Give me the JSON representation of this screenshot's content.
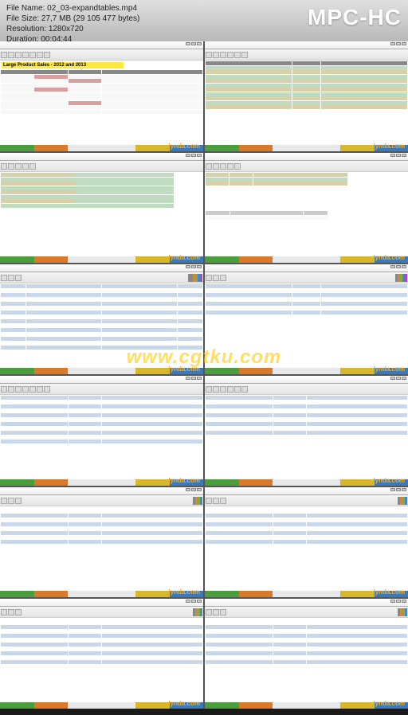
{
  "player": {
    "filename_label": "File Name:",
    "filename": "02_03-expandtables.mp4",
    "filesize_label": "File Size:",
    "filesize": "27,7 MB (29 105 477 bytes)",
    "resolution_label": "Resolution:",
    "resolution": "1280x720",
    "duration_label": "Duration:",
    "duration": "00:04:44",
    "app_title": "MPC-HC"
  },
  "watermark": "www.cgtku.com",
  "thumb_watermark": "lynda.com",
  "thumbnails": {
    "t1": {
      "title": "Large Product Sales - 2012 and 2013"
    }
  }
}
